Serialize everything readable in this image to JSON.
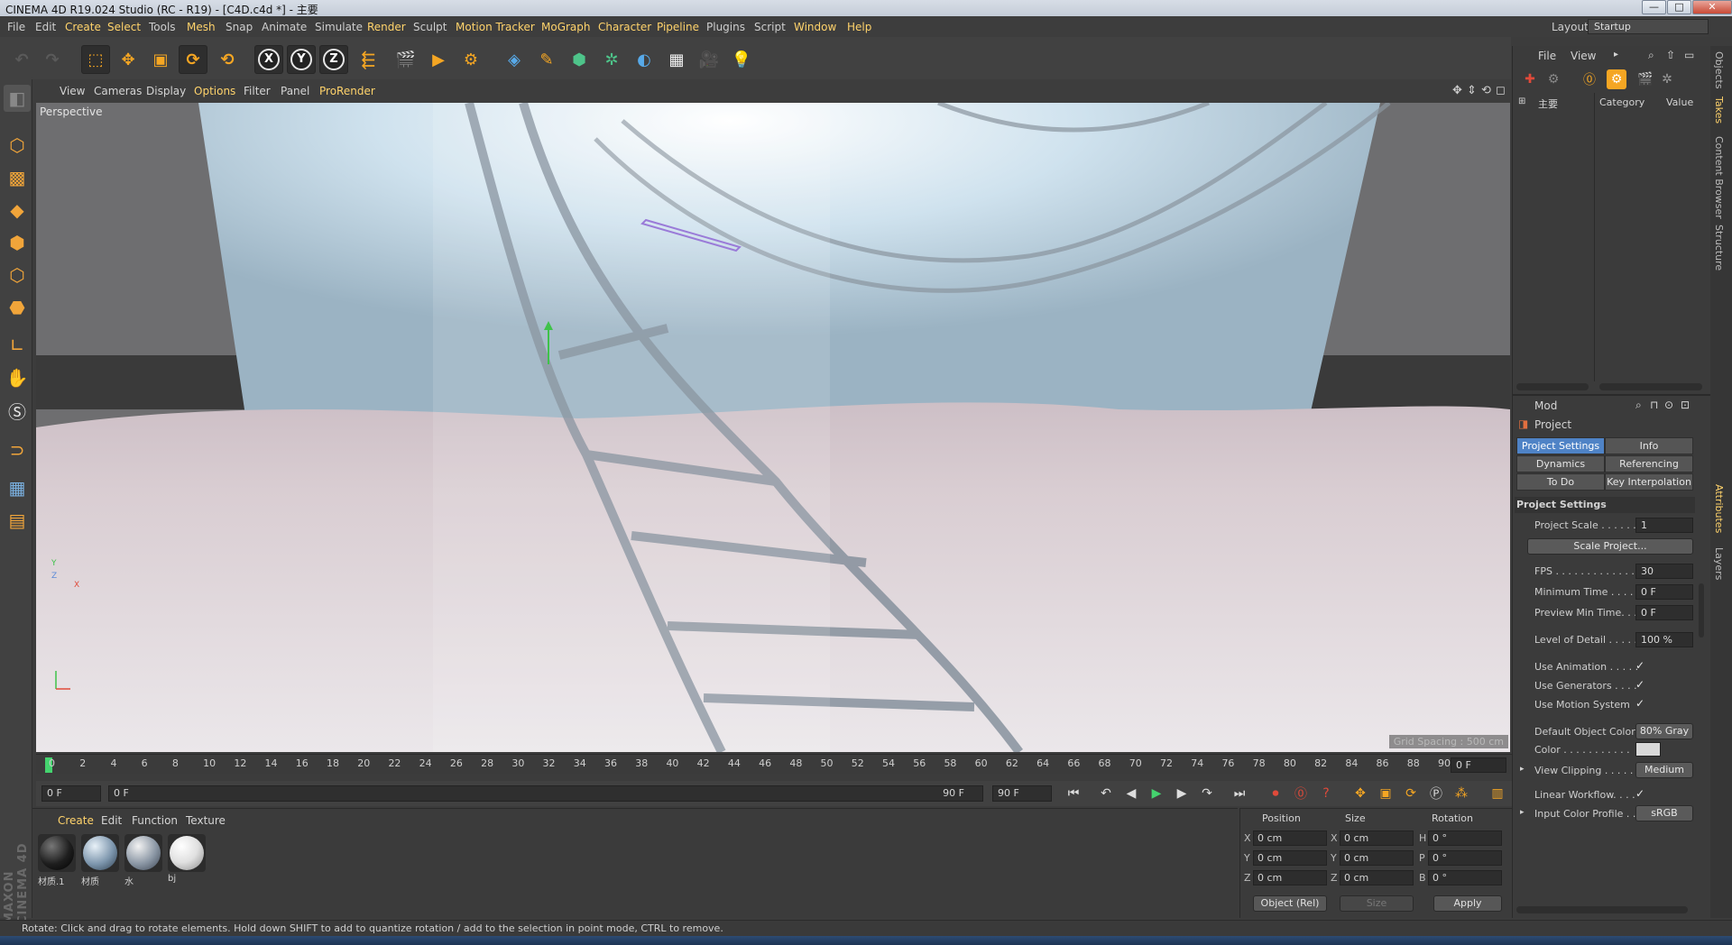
{
  "window": {
    "title": "CINEMA 4D R19.024 Studio (RC - R19) - [C4D.c4d *] - 主要",
    "buttons": {
      "minimize": "—",
      "maximize": "□",
      "close": "✕"
    }
  },
  "menubar": {
    "items": [
      "File",
      "Edit",
      "Create",
      "Select",
      "Tools",
      "Mesh",
      "Snap",
      "Animate",
      "Simulate",
      "Render",
      "Sculpt",
      "Motion Tracker",
      "MoGraph",
      "Character",
      "Pipeline",
      "Plugins",
      "Script",
      "Window",
      "Help"
    ],
    "highlighted": [
      "Create",
      "Select",
      "Mesh",
      "Render",
      "Motion Tracker",
      "MoGraph",
      "Character",
      "Pipeline",
      "Window",
      "Help"
    ],
    "layout_label": "Layout:",
    "layout_value": "Startup"
  },
  "toolbar": {
    "axis_x": "X",
    "axis_y": "Y",
    "axis_z": "Z"
  },
  "viewport": {
    "menu": [
      "View",
      "Cameras",
      "Display",
      "Options",
      "Filter",
      "Panel",
      "ProRender"
    ],
    "highlighted": [
      "Options",
      "ProRender"
    ],
    "label": "Perspective",
    "grid_spacing": "Grid Spacing : 500 cm",
    "axis_y": "Y",
    "axis_z": "Z",
    "axis_x": "X"
  },
  "timeline": {
    "ticks": [
      "0",
      "2",
      "4",
      "6",
      "8",
      "10",
      "12",
      "14",
      "16",
      "18",
      "20",
      "22",
      "24",
      "26",
      "28",
      "30",
      "32",
      "34",
      "36",
      "38",
      "40",
      "42",
      "44",
      "46",
      "48",
      "50",
      "52",
      "54",
      "56",
      "58",
      "60",
      "62",
      "64",
      "66",
      "68",
      "70",
      "72",
      "74",
      "76",
      "78",
      "80",
      "82",
      "84",
      "86",
      "88",
      "90"
    ],
    "current_frame": "0 F"
  },
  "transport": {
    "start_frame": "0 F",
    "range_start": "0 F",
    "range_end": "90 F",
    "end_frame": "90 F"
  },
  "material_manager": {
    "menu": [
      "Create",
      "Edit",
      "Function",
      "Texture"
    ],
    "materials": [
      {
        "name": "材质.1",
        "color": "#1e1e1e"
      },
      {
        "name": "材质",
        "color": "#7d96ad"
      },
      {
        "name": "水",
        "color": "#8a96a4"
      },
      {
        "name": "bj",
        "color": "#e0e0e0"
      }
    ],
    "watermark": "MAXON CINEMA 4D"
  },
  "coordinates": {
    "headers": {
      "position": "Position",
      "size": "Size",
      "rotation": "Rotation"
    },
    "rows": [
      {
        "axis": "X",
        "pos": "0 cm",
        "size_axis": "X",
        "size": "0 cm",
        "rot_axis": "H",
        "rot": "0 °"
      },
      {
        "axis": "Y",
        "pos": "0 cm",
        "size_axis": "Y",
        "size": "0 cm",
        "rot_axis": "P",
        "rot": "0 °"
      },
      {
        "axis": "Z",
        "pos": "0 cm",
        "size_axis": "Z",
        "size": "0 cm",
        "rot_axis": "B",
        "rot": "0 °"
      }
    ],
    "mode": "Object (Rel)",
    "size_mode": "Size",
    "apply": "Apply"
  },
  "status": "Rotate: Click and drag to rotate elements. Hold down SHIFT to add to quantize rotation / add to the selection in point mode, CTRL to remove.",
  "right_panel": {
    "obj_menu": [
      "File",
      "View"
    ],
    "takes_cols": {
      "main": "主要",
      "category": "Category",
      "value": "Value"
    },
    "attr_menu": "Mod",
    "project_label": "Project",
    "tabs": [
      {
        "label": "Project Settings",
        "active": true
      },
      {
        "label": "Info",
        "active": false
      },
      {
        "label": "Dynamics",
        "active": false
      },
      {
        "label": "Referencing",
        "active": false
      },
      {
        "label": "To Do",
        "active": false
      },
      {
        "label": "Key Interpolation",
        "active": false
      }
    ],
    "section_title": "Project Settings",
    "project_scale_label": "Project Scale . . . . . .",
    "project_scale": "1",
    "scale_project_btn": "Scale Project...",
    "fps_label": "FPS . . . . . . . . . . . . .",
    "fps": "30",
    "min_time_label": "Minimum Time . . . .",
    "min_time": "0 F",
    "preview_min_label": "Preview Min Time. . .",
    "preview_min": "0 F",
    "lod_label": "Level of Detail . . . . .",
    "lod": "100 %",
    "use_animation_label": "Use Animation . . . . .",
    "use_generators_label": "Use Generators . . . .",
    "use_motion_label": "Use Motion System",
    "check": "✓",
    "default_color_label": "Default Object Color",
    "default_color": "80% Gray",
    "color_label": "Color . . . . . . . . . . .",
    "color_swatch": "#d9d9d9",
    "view_clipping_label": "View Clipping . . . . .",
    "view_clipping": "Medium",
    "linear_workflow_label": "Linear Workflow. . . .",
    "input_profile_label": "Input Color Profile . .",
    "input_profile": "sRGB"
  },
  "vertical_tabs": [
    "Objects",
    "Takes",
    "Content Browser",
    "Structure",
    "Attributes",
    "Layers"
  ],
  "colors": {
    "accent": "#ffd36b",
    "active_tab": "#4f83c6",
    "playhead": "#44d36e",
    "tool_orange": "#f5a623"
  }
}
